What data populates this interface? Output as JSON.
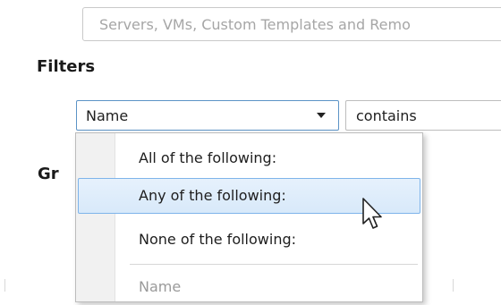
{
  "scope": {
    "text": "Servers, VMs, Custom Templates and Remo"
  },
  "filters": {
    "heading": "Filters",
    "field_select_value": "Name",
    "operator_value": "contains"
  },
  "group": {
    "heading": "Gr"
  },
  "menu": {
    "items": [
      {
        "label": "All of the following:",
        "highlighted": false
      },
      {
        "label": "Any of the following:",
        "highlighted": true
      },
      {
        "label": "None of the following:",
        "highlighted": false
      },
      {
        "label": "Name",
        "highlighted": false
      }
    ]
  },
  "colors": {
    "highlight_border": "#7eb4ea",
    "highlight_fill": "#d8e9fa",
    "focus_border": "#5c93c6"
  },
  "icons": {
    "dropdown": "chevron-down-icon",
    "cursor": "mouse-pointer-icon"
  }
}
